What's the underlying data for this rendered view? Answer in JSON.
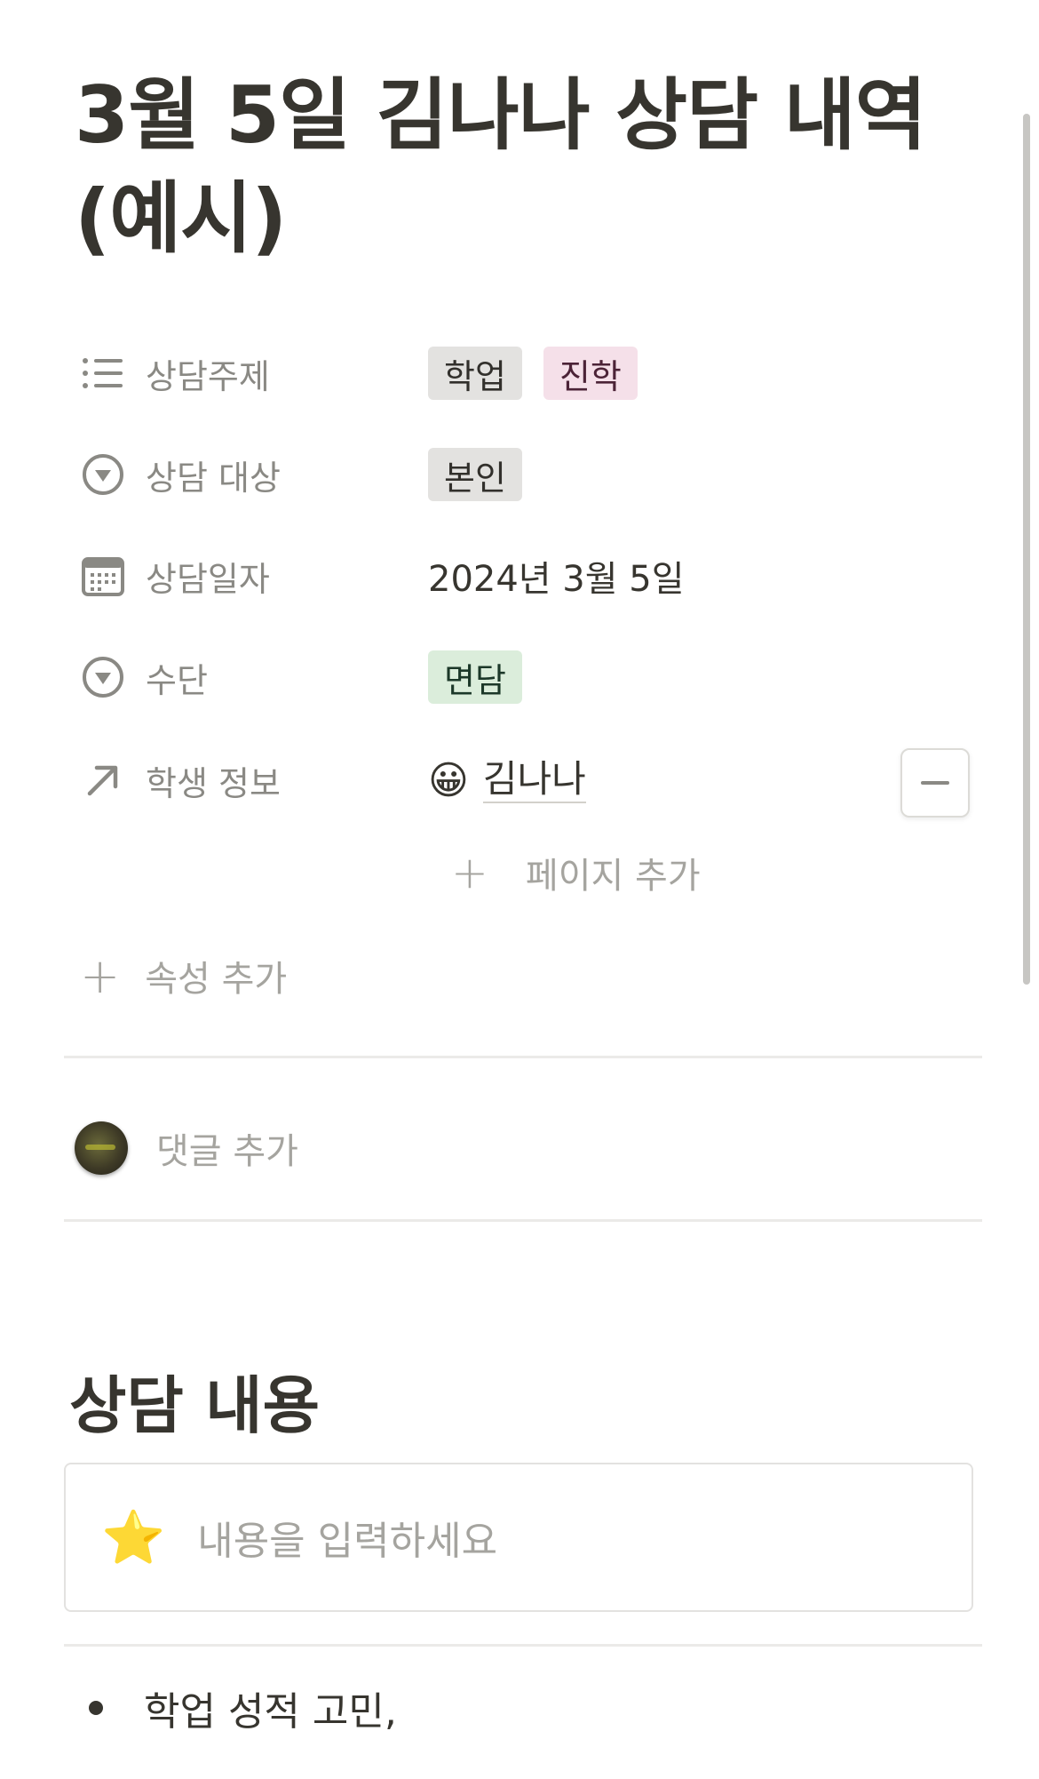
{
  "page": {
    "title": "3월 5일 김나나 상담 내역 (예시)"
  },
  "properties": [
    {
      "label": "상담주제",
      "icon": "list-icon",
      "tags": [
        {
          "text": "학업",
          "color": "#e3e2e0"
        },
        {
          "text": "진학",
          "color": "#f5e0e9"
        }
      ]
    },
    {
      "label": "상담 대상",
      "icon": "select-icon",
      "tags": [
        {
          "text": "본인",
          "color": "#e3e2e0"
        }
      ]
    },
    {
      "label": "상담일자",
      "icon": "calendar-icon",
      "value": "2024년 3월 5일"
    },
    {
      "label": "수단",
      "icon": "select-icon",
      "tags": [
        {
          "text": "면담",
          "color": "#dbeddb"
        }
      ]
    },
    {
      "label": "학생 정보",
      "icon": "relation-arrow-icon",
      "relation": {
        "emoji": "😀",
        "text": "김나나"
      }
    }
  ],
  "actions": {
    "add_page": "페이지 추가",
    "add_property": "속성 추가",
    "add_comment": "댓글 추가"
  },
  "content": {
    "heading": "상담 내용",
    "callout_placeholder": "내용을 입력하세요",
    "callout_icon": "⭐",
    "bullets": [
      "학업 성적 고민,"
    ]
  }
}
